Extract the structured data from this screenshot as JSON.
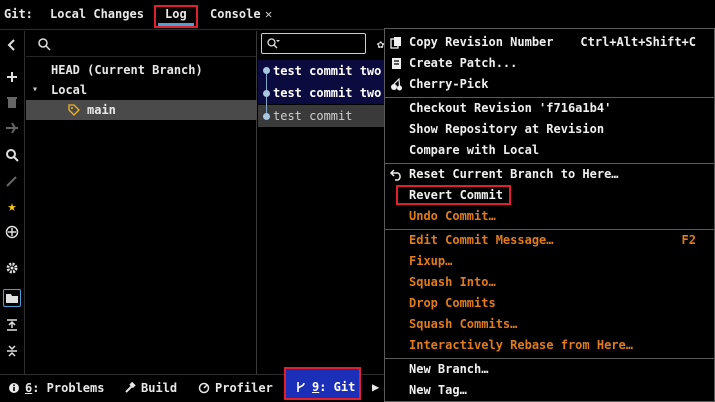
{
  "topbar": {
    "git_label": "Git:",
    "tabs": [
      {
        "label": "Local Changes"
      },
      {
        "label": "Log"
      },
      {
        "label": "Console"
      }
    ],
    "close_glyph": "✕"
  },
  "branch_tree": {
    "rows": [
      {
        "label": "HEAD (Current Branch)"
      },
      {
        "label": "Local"
      },
      {
        "label": "main"
      }
    ]
  },
  "commits": {
    "rows": [
      {
        "label": "test commit two"
      },
      {
        "label": "test commit two"
      },
      {
        "label": "test commit"
      }
    ]
  },
  "context_menu": {
    "items": [
      {
        "label": "Copy Revision Number",
        "shortcut": "Ctrl+Alt+Shift+C",
        "icon": "copy-icon"
      },
      {
        "label": "Create Patch...",
        "icon": "patch-icon"
      },
      {
        "label": "Cherry-Pick",
        "icon": "cherry-icon"
      },
      {
        "label": "Checkout Revision 'f716a1b4'"
      },
      {
        "label": "Show Repository at Revision"
      },
      {
        "label": "Compare with Local"
      },
      {
        "label": "Reset Current Branch to Here…",
        "icon": "undo-icon"
      },
      {
        "label": "Revert Commit"
      },
      {
        "label": "Undo Commit…"
      },
      {
        "label": "Edit Commit Message…",
        "shortcut": "F2"
      },
      {
        "label": "Fixup…"
      },
      {
        "label": "Squash Into…"
      },
      {
        "label": "Drop Commits"
      },
      {
        "label": "Squash Commits…"
      },
      {
        "label": "Interactively Rebase from Here…"
      },
      {
        "label": "New Branch…"
      },
      {
        "label": "New Tag…"
      }
    ]
  },
  "bottombar": {
    "problems_num": "6",
    "problems_label": ": Problems",
    "build_label": "Build",
    "profiler_label": "Profiler",
    "git_num": "9",
    "git_label": ": Git"
  },
  "colors": {
    "accent_blue": "#4ea0d8",
    "highlight_red": "#e0202a",
    "disabled_orange": "#e07b1f",
    "selected_commit_bg": "#0b0b40",
    "git_button_bg": "#1c2fb8"
  }
}
